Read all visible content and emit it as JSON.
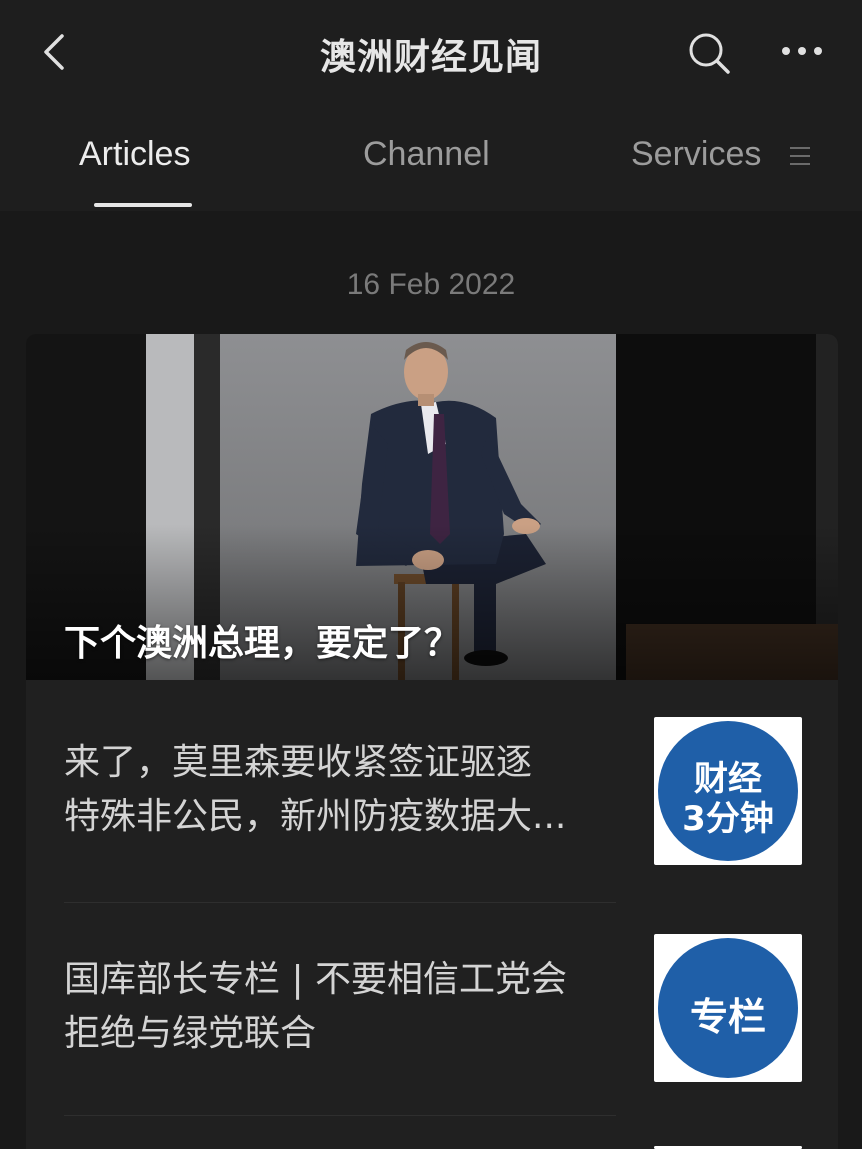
{
  "header": {
    "title": "澳洲财经见闻"
  },
  "tabs": [
    {
      "label": "Articles",
      "active": true
    },
    {
      "label": "Channel",
      "active": false
    },
    {
      "label": "Services",
      "active": false
    }
  ],
  "feed": {
    "date": "16 Feb 2022",
    "hero": {
      "caption": "下个澳洲总理，要定了？"
    },
    "items": [
      {
        "title_line1": "来了，莫里森要收紧签证驱逐",
        "title_line2": "特殊非公民，新州防疫数据大...",
        "thumb_line1": "财经",
        "thumb_line2": "3分钟"
      },
      {
        "title_line1": "国库部长专栏 | 不要相信工党会",
        "title_line2": "拒绝与绿党联合",
        "thumb_line1": "专栏"
      }
    ]
  },
  "colors": {
    "accent": "#1f5fa8",
    "background": "#191919",
    "bar": "#1e1e1e"
  },
  "icons": {
    "back": "chevron-left-icon",
    "search": "search-icon",
    "more": "more-dots-icon",
    "menu": "menu-lines-icon"
  }
}
